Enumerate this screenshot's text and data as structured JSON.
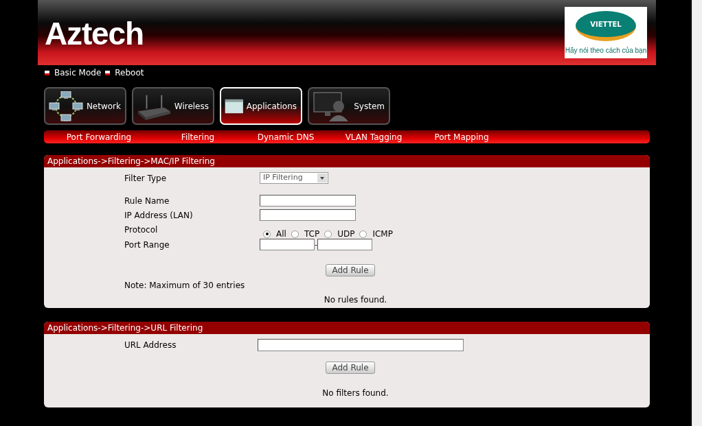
{
  "header": {
    "brand": "Aztech",
    "logo": {
      "name": "VIETTEL",
      "slogan": "Hãy nói theo cách của bạn"
    }
  },
  "top_links": [
    "Basic Mode",
    "Reboot"
  ],
  "tabs": [
    {
      "label": "Network",
      "kind": "network",
      "selected": false
    },
    {
      "label": "Wireless",
      "kind": "wireless",
      "selected": false
    },
    {
      "label": "Applications",
      "kind": "applications",
      "selected": true
    },
    {
      "label": "System",
      "kind": "system",
      "selected": false
    }
  ],
  "subnav": [
    "Port Forwarding",
    "Filtering",
    "Dynamic DNS",
    "VLAN Tagging",
    "Port Mapping"
  ],
  "ip_panel": {
    "title": "Applications->Filtering->MAC/IP Filtering",
    "filter_type": {
      "label": "Filter Type",
      "value": "IP Filtering"
    },
    "rule_name": {
      "label": "Rule Name"
    },
    "ip_address": {
      "label": "IP Address (LAN)"
    },
    "protocol": {
      "label": "Protocol",
      "options": [
        {
          "label": "All",
          "selected": true
        },
        {
          "label": "TCP",
          "selected": false
        },
        {
          "label": "UDP",
          "selected": false
        },
        {
          "label": "ICMP",
          "selected": false
        }
      ]
    },
    "port_range": {
      "label": "Port Range",
      "separator": "-"
    },
    "button": "Add Rule",
    "note": "Note: Maximum of 30 entries",
    "empty": "No rules found."
  },
  "url_panel": {
    "title": "Applications->Filtering->URL Filtering",
    "url_address": {
      "label": "URL Address"
    },
    "button": "Add Rule",
    "empty": "No filters found."
  }
}
